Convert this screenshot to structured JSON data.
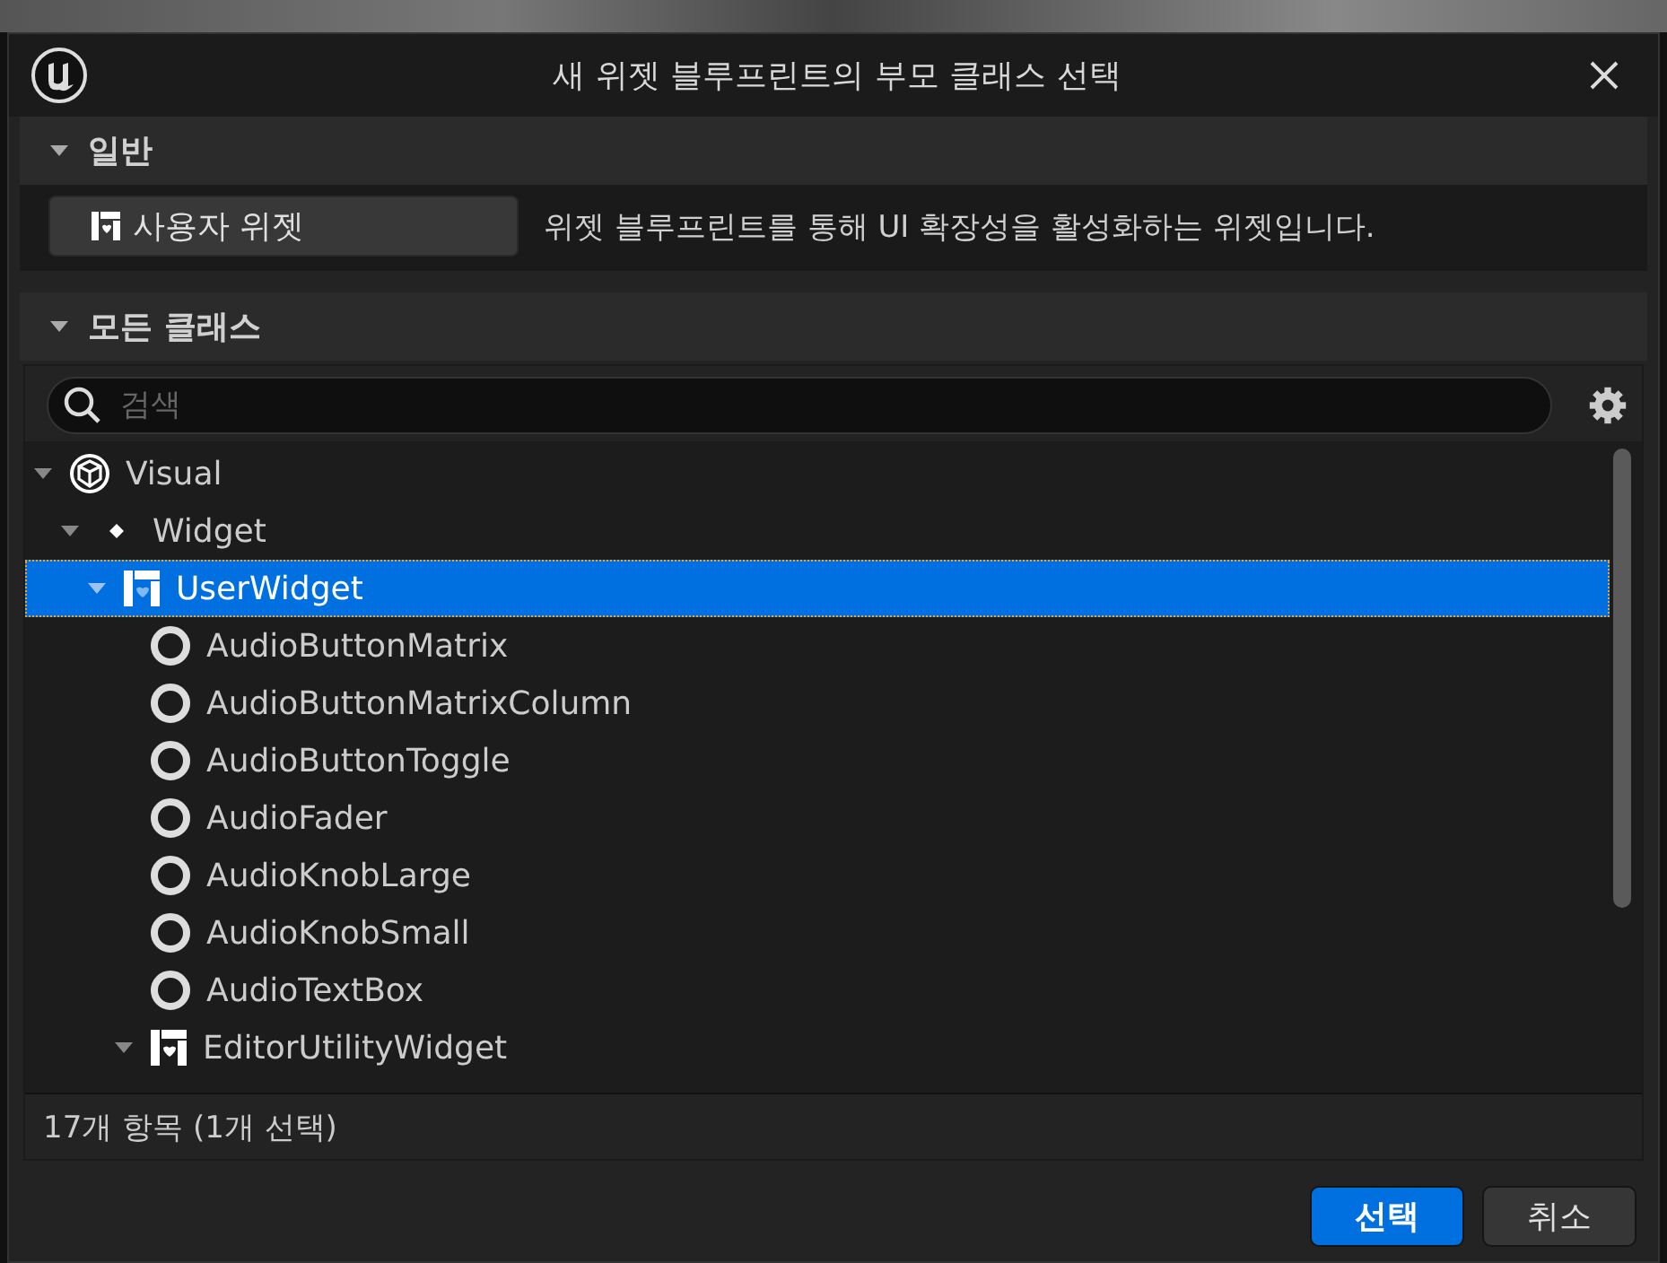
{
  "window": {
    "title": "새 위젯 블루프린트의 부모 클래스 선택"
  },
  "common_section": {
    "title": "일반",
    "expanded": true,
    "items": [
      {
        "label": "사용자 위젯",
        "description": "위젯 블루프린트를 통해 UI 확장성을 활성화하는 위젯입니다."
      }
    ]
  },
  "all_classes_section": {
    "title": "모든 클래스",
    "expanded": true,
    "search": {
      "placeholder": "검색"
    },
    "tree": [
      {
        "label": "Visual",
        "kind": "cube",
        "expanded": true,
        "selected": false,
        "children": [
          {
            "label": "Widget",
            "kind": "dot",
            "expanded": true,
            "selected": false,
            "children": [
              {
                "label": "UserWidget",
                "kind": "widget",
                "expanded": true,
                "selected": true,
                "children": [
                  {
                    "label": "AudioButtonMatrix",
                    "kind": "ring",
                    "selected": false
                  },
                  {
                    "label": "AudioButtonMatrixColumn",
                    "kind": "ring",
                    "selected": false
                  },
                  {
                    "label": "AudioButtonToggle",
                    "kind": "ring",
                    "selected": false
                  },
                  {
                    "label": "AudioFader",
                    "kind": "ring",
                    "selected": false
                  },
                  {
                    "label": "AudioKnobLarge",
                    "kind": "ring",
                    "selected": false
                  },
                  {
                    "label": "AudioKnobSmall",
                    "kind": "ring",
                    "selected": false
                  },
                  {
                    "label": "AudioTextBox",
                    "kind": "ring",
                    "selected": false
                  },
                  {
                    "label": "EditorUtilityWidget",
                    "kind": "widget",
                    "expanded": true,
                    "selected": false
                  }
                ]
              }
            ]
          }
        ]
      }
    ],
    "status": "17개 항목 (1개 선택)"
  },
  "buttons": [
    {
      "label": "선택",
      "kind": "primary"
    },
    {
      "label": "취소",
      "kind": "secondary"
    }
  ]
}
